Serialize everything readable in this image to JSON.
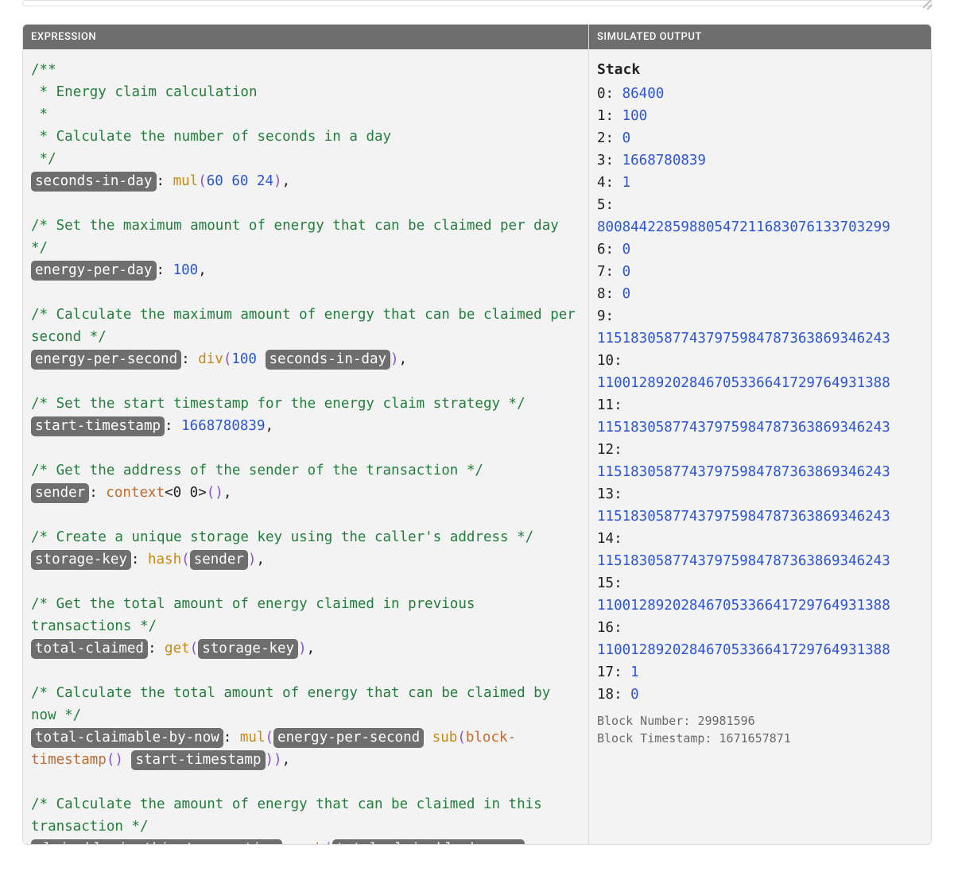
{
  "headers": {
    "expression": "EXPRESSION",
    "simulated_output": "SIMULATED OUTPUT"
  },
  "expression": {
    "comment_block": [
      "/**",
      " * Energy claim calculation",
      " *",
      " * Calculate the number of seconds in a day",
      " */"
    ],
    "line_seconds_in_day": {
      "tag": "seconds-in-day",
      "func": "mul",
      "args": "60 60 24"
    },
    "comment_energy_per_day": "/* Set the maximum amount of energy that can be claimed per day */",
    "line_energy_per_day": {
      "tag": "energy-per-day",
      "value": "100"
    },
    "comment_energy_per_second": "/* Calculate the maximum amount of energy that can be claimed per second */",
    "line_energy_per_second": {
      "tag": "energy-per-second",
      "func": "div",
      "arg1": "100",
      "argtag": "seconds-in-day"
    },
    "comment_start_timestamp": "/* Set the start timestamp for the energy claim strategy */",
    "line_start_timestamp": {
      "tag": "start-timestamp",
      "value": "1668780839"
    },
    "comment_sender": "/* Get the address of the sender of the transaction */",
    "line_sender": {
      "tag": "sender",
      "func": "context",
      "angles": "<0 0>"
    },
    "comment_storage_key": "/* Create a unique storage key using the caller's address */",
    "line_storage_key": {
      "tag": "storage-key",
      "func": "hash",
      "argtag": "sender"
    },
    "comment_total_claimed": "/* Get the total amount of energy claimed in previous transactions */",
    "line_total_claimed": {
      "tag": "total-claimed",
      "func": "get",
      "argtag": "storage-key"
    },
    "comment_total_claimable": "/* Calculate the total amount of energy that can be claimed by now */",
    "line_total_claimable": {
      "tag": "total-claimable-by-now",
      "func1": "mul",
      "argtag1": "energy-per-second",
      "func2": "sub",
      "func3": "block-timestamp",
      "argtag2": "start-timestamp"
    },
    "comment_claimable_in_tx": "/* Calculate the amount of energy that can be claimed in this transaction */",
    "line_claimable_in_tx": {
      "tag": "claimable-in-this-transaction",
      "func": "sub",
      "argtag": "total-claimable-by-now"
    }
  },
  "stack": {
    "title": "Stack",
    "items": [
      {
        "idx": "0",
        "val": "86400"
      },
      {
        "idx": "1",
        "val": "100"
      },
      {
        "idx": "2",
        "val": "0"
      },
      {
        "idx": "3",
        "val": "1668780839"
      },
      {
        "idx": "4",
        "val": "1"
      },
      {
        "idx": "5",
        "val": "80084422859880547211683076133703299"
      },
      {
        "idx": "6",
        "val": "0"
      },
      {
        "idx": "7",
        "val": "0"
      },
      {
        "idx": "8",
        "val": "0"
      },
      {
        "idx": "9",
        "val": "11518305877437975984787363869346243"
      },
      {
        "idx": "10",
        "val": "11001289202846705336641729764931388"
      },
      {
        "idx": "11",
        "val": "11518305877437975984787363869346243"
      },
      {
        "idx": "12",
        "val": "11518305877437975984787363869346243"
      },
      {
        "idx": "13",
        "val": "11518305877437975984787363869346243"
      },
      {
        "idx": "14",
        "val": "11518305877437975984787363869346243"
      },
      {
        "idx": "15",
        "val": "11001289202846705336641729764931388"
      },
      {
        "idx": "16",
        "val": "11001289202846705336641729764931388"
      },
      {
        "idx": "17",
        "val": "1"
      },
      {
        "idx": "18",
        "val": "0"
      }
    ],
    "block_number_label": "Block Number:",
    "block_number": "29981596",
    "block_timestamp_label": "Block Timestamp:",
    "block_timestamp": "1671657871"
  }
}
